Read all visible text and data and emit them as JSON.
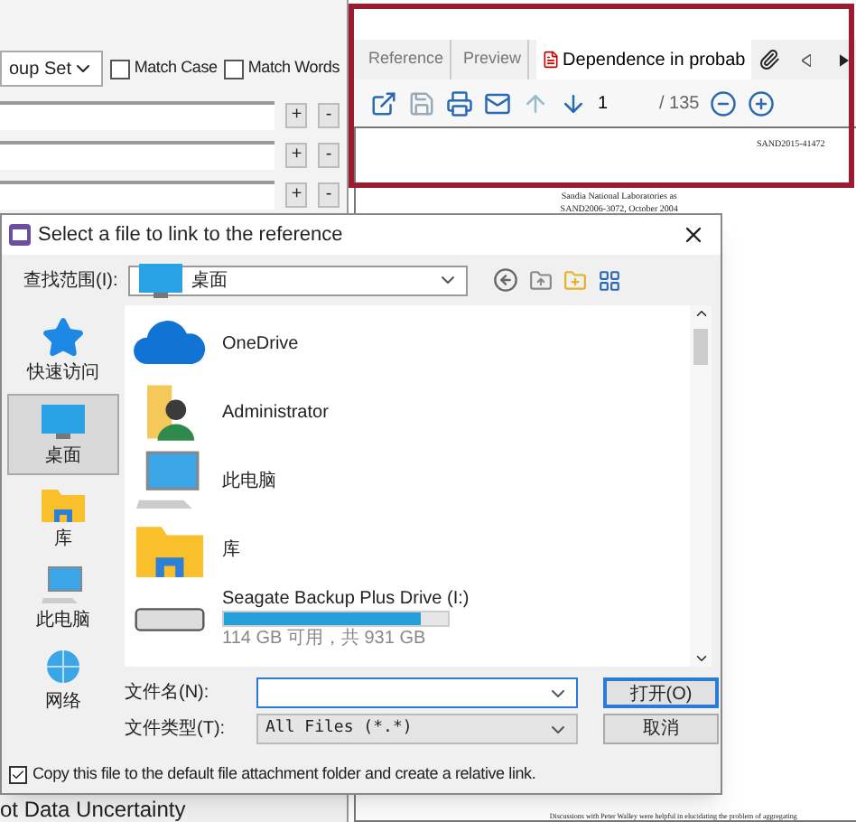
{
  "search_panel": {
    "group_set": "oup Set",
    "options": [
      {
        "label": "Match Case",
        "checked": false
      },
      {
        "label": "Match Words",
        "checked": false
      }
    ],
    "rows": [
      {
        "add": "+",
        "remove": "-"
      },
      {
        "add": "+",
        "remove": "-"
      },
      {
        "add": "+",
        "remove": "-"
      }
    ]
  },
  "viewer": {
    "tabs": [
      {
        "label": "Reference",
        "selected": false,
        "kind": "plain"
      },
      {
        "label": "Preview",
        "selected": false,
        "kind": "plain"
      },
      {
        "label": "Dependence in probab",
        "selected": true,
        "kind": "pdf"
      }
    ],
    "page": "1",
    "page_total": "/ 135",
    "document_lines": [
      "SAND2015-41472",
      "Sandia National Laboratories as",
      "SAND2006-3072, October 2004"
    ],
    "footer_line": "Discussions with Peter Walley were helpful in elucidating the problem of aggregating"
  },
  "background_heading": "ot Data Uncertainty",
  "dialog": {
    "title": "Select a file to link to the reference",
    "look_in_label": "查找范围(I):",
    "look_in_value": "桌面",
    "places": [
      {
        "label": "快速访问",
        "kind": "star",
        "selected": false
      },
      {
        "label": "桌面",
        "kind": "desktop",
        "selected": true
      },
      {
        "label": "库",
        "kind": "library",
        "selected": false
      },
      {
        "label": "此电脑",
        "kind": "computer",
        "selected": false
      },
      {
        "label": "网络",
        "kind": "network",
        "selected": false
      }
    ],
    "files": [
      {
        "name": "OneDrive",
        "kind": "cloud"
      },
      {
        "name": "Administrator",
        "kind": "user"
      },
      {
        "name": "此电脑",
        "kind": "computer"
      },
      {
        "name": "库",
        "kind": "library"
      },
      {
        "name": "Seagate Backup Plus Drive (I:)",
        "kind": "drive",
        "level": 0.88,
        "detail": "114 GB 可用，共 931 GB"
      }
    ],
    "file_name_label": "文件名(N):",
    "file_type_label": "文件类型(T):",
    "file_type_value": "All Files (*.*)",
    "open_button": "打开(O)",
    "cancel_button": "取消",
    "copy_option": {
      "label": "Copy this file to the default file attachment folder and create a relative link.",
      "checked": true
    }
  }
}
